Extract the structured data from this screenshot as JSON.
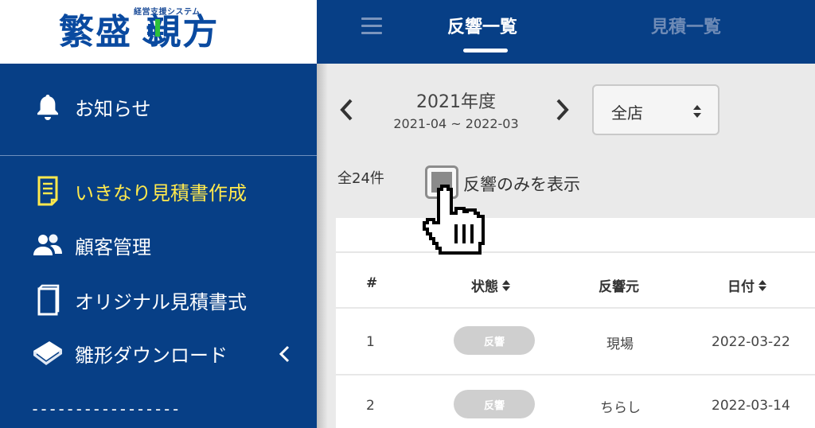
{
  "logo": {
    "tagline": "経営支援システム",
    "title": "繁盛 親方"
  },
  "sidebar": {
    "items": [
      {
        "label": "お知らせ",
        "icon": "bell-icon"
      },
      {
        "label": "いきなり見積書作成",
        "icon": "document-icon",
        "active": true
      },
      {
        "label": "顧客管理",
        "icon": "users-icon"
      },
      {
        "label": "オリジナル見積書式",
        "icon": "book-icon"
      },
      {
        "label": "雛形ダウンロード",
        "icon": "download-book-icon"
      }
    ],
    "dashes": "-----------------"
  },
  "topbar": {
    "tabs": [
      {
        "label": "反響一覧",
        "active": true
      },
      {
        "label": "見積一覧",
        "active": false
      }
    ]
  },
  "filter": {
    "fiscal_year": "2021年度",
    "range": "2021-04 ~ 2022-03",
    "store_select": "全店"
  },
  "summary": {
    "count": "全24件",
    "checkbox_label": "反響のみを表示"
  },
  "table": {
    "columns": [
      "#",
      "状態",
      "反響元",
      "日付"
    ],
    "rows": [
      {
        "no": "1",
        "status": "反響",
        "source": "現場",
        "date": "2022-03-22"
      },
      {
        "no": "2",
        "status": "反響",
        "source": "ちらし",
        "date": "2022-03-14"
      }
    ]
  },
  "colors": {
    "navy": "#073f86",
    "active_yellow": "#ffe94d",
    "badge_gray": "#cfcfcf"
  }
}
